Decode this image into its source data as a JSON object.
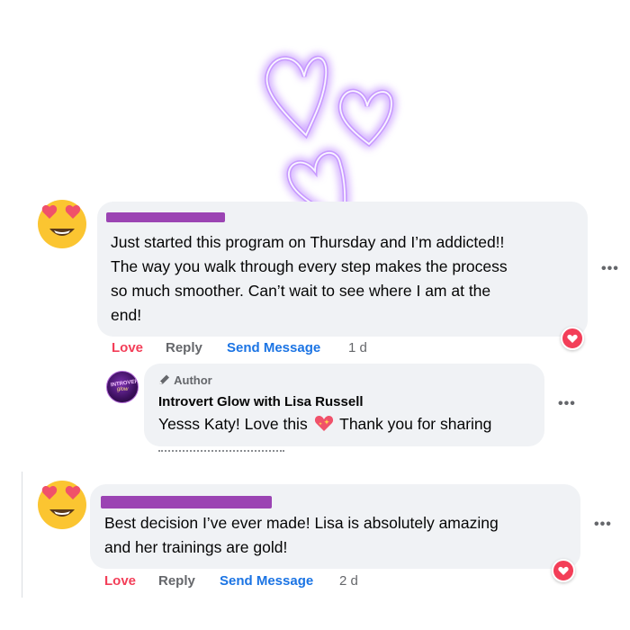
{
  "comments": [
    {
      "text_lines": [
        "Just started this program on Thursday and I’m addicted!!",
        "The way you walk through every step makes the process",
        "so much smoother. Can’t wait to see where I am at the",
        "end!"
      ],
      "redact_color": "#9b44b3",
      "actions": {
        "love": "Love",
        "reply": "Reply",
        "send": "Send Message",
        "time": "1 d"
      },
      "reaction": "heart"
    },
    {
      "text_lines": [
        "Best decision I’ve ever made! Lisa is absolutely amazing",
        "and her trainings are gold!"
      ],
      "redact_color": "#9b44b3",
      "actions": {
        "love": "Love",
        "reply": "Reply",
        "send": "Send Message",
        "time": "2 d"
      },
      "reaction": "heart"
    }
  ],
  "reply": {
    "author_badge": "Author",
    "name": "Introvert Glow with Lisa Russell",
    "text_before": "Yesss Katy! Love this",
    "text_after": "Thank you for sharing",
    "avatar_text": [
      "INTROVERT",
      "glow"
    ]
  },
  "more_label": "•••",
  "colors": {
    "bubble": "#f0f2f5",
    "love": "#f33e58",
    "link": "#1b74e4",
    "muted": "#65676b",
    "neon": "#b77cff"
  },
  "icons": [
    "heart-eyes-emoji",
    "neon-hearts",
    "pencil-icon",
    "sparkling-heart-emoji",
    "heart-reaction-icon"
  ]
}
